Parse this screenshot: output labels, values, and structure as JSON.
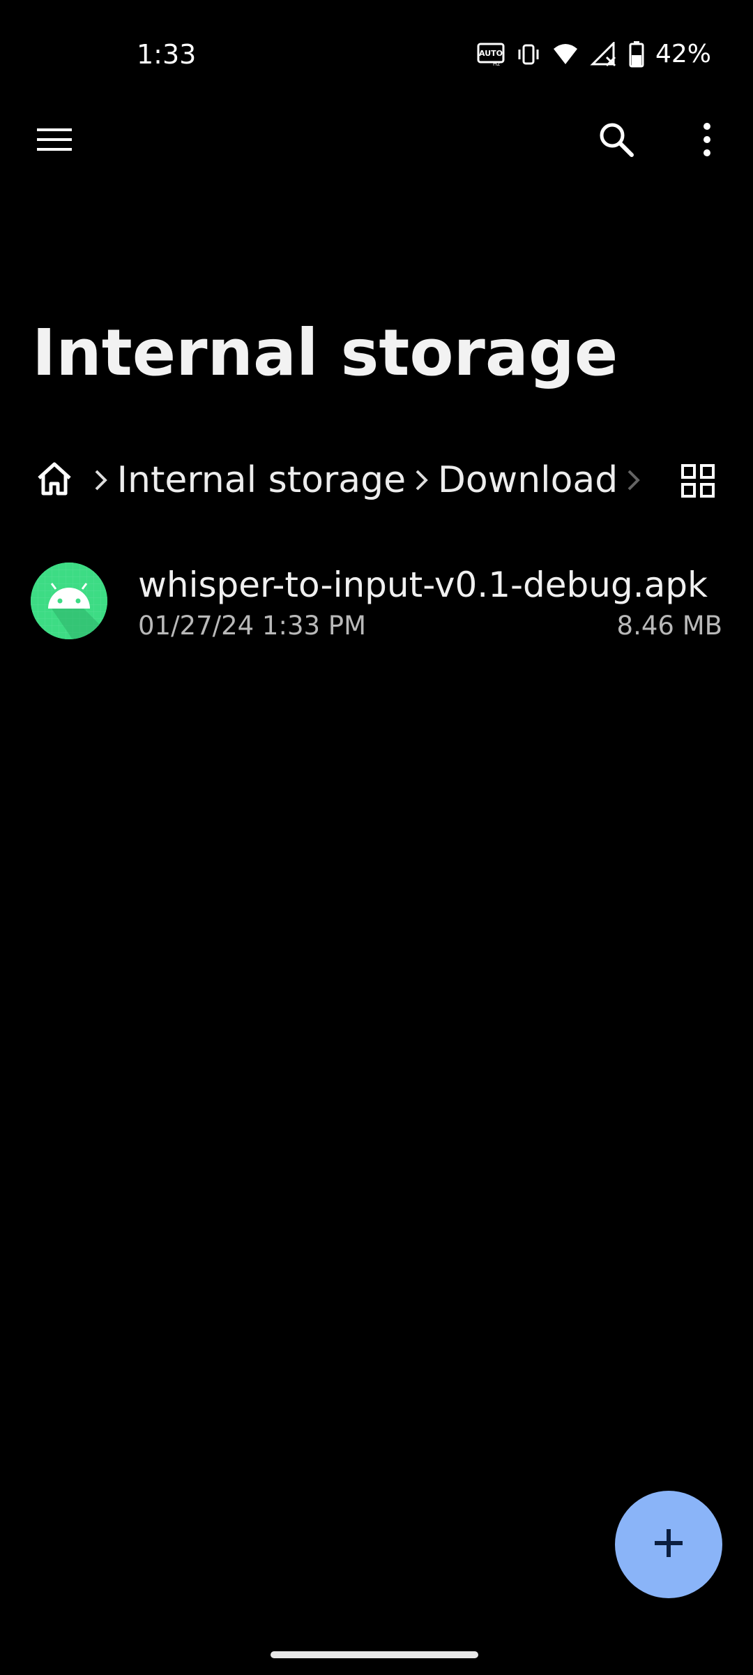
{
  "status_bar": {
    "time": "1:33",
    "battery_percent": "42%",
    "icons": [
      "auto-hz-icon",
      "vibrate-icon",
      "wifi-icon",
      "no-signal-icon",
      "battery-icon"
    ]
  },
  "app_bar": {
    "icons": [
      "menu-icon",
      "search-icon",
      "more-vert-icon"
    ]
  },
  "title": "Internal storage",
  "breadcrumb": {
    "items": [
      {
        "label": "",
        "icon": "home-icon"
      },
      {
        "label": "Internal storage"
      },
      {
        "label": "Download"
      }
    ],
    "view_toggle_icon": "grid-view-icon"
  },
  "files": [
    {
      "name": "whisper-to-input-v0.1-debug.apk",
      "date": "01/27/24 1:33 PM",
      "size": "8.46 MB",
      "icon": "android-apk-icon"
    }
  ],
  "fab": {
    "icon": "plus-icon"
  },
  "colors": {
    "background": "#000000",
    "fab": "#8AB4F8",
    "apk_icon": "#3DDC84",
    "primary_text": "#F0F0F0",
    "secondary_text": "#B9B9B9"
  }
}
